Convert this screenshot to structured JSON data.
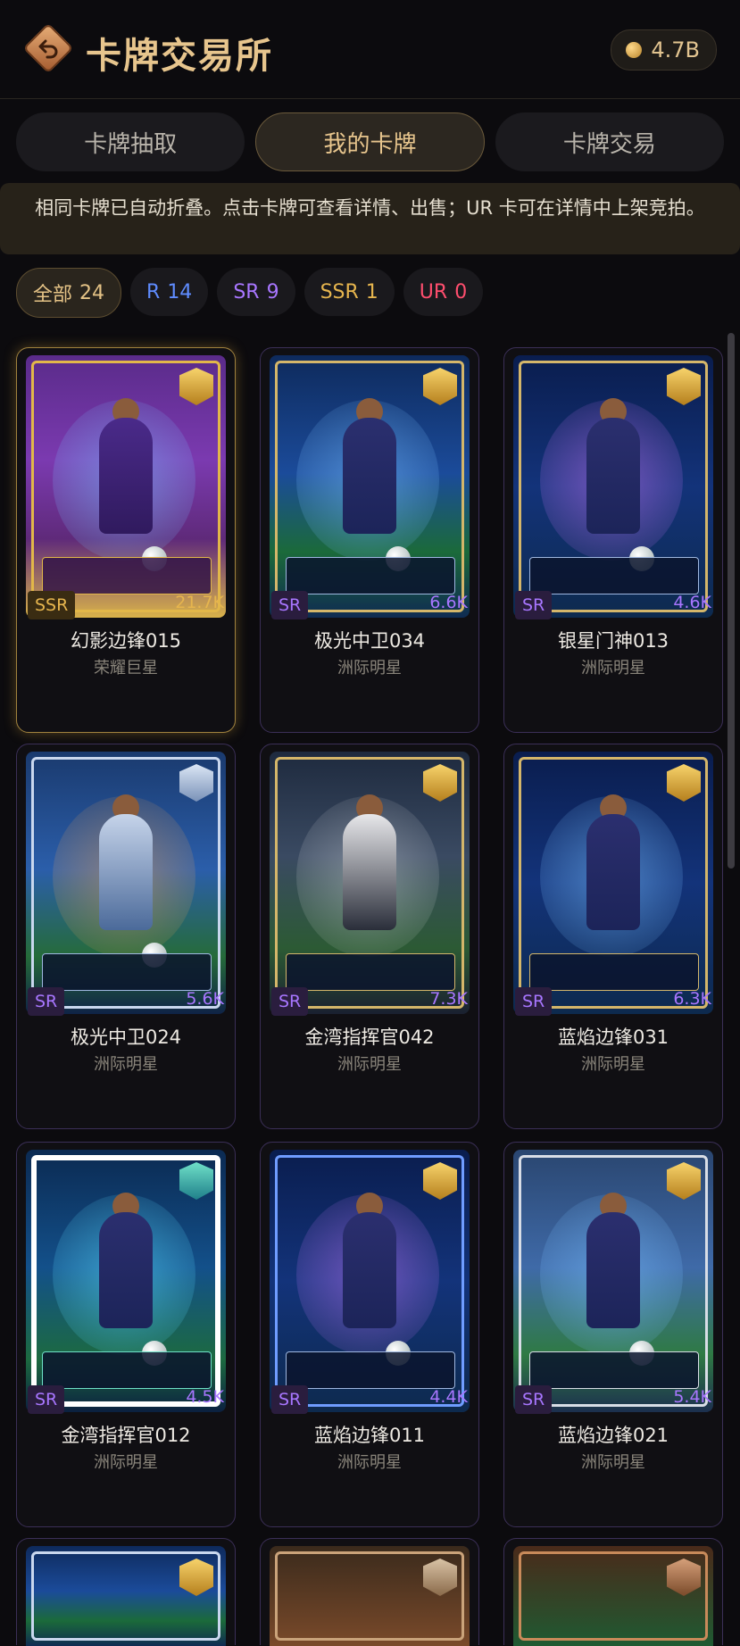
{
  "header": {
    "title": "卡牌交易所",
    "coins": "4.7B"
  },
  "tabs": [
    {
      "label": "卡牌抽取",
      "active": false
    },
    {
      "label": "我的卡牌",
      "active": true
    },
    {
      "label": "卡牌交易",
      "active": false
    }
  ],
  "notice": "相同卡牌已自动折叠。点击卡牌可查看详情、出售；UR 卡可在详情中上架竞拍。",
  "filters": [
    {
      "label": "全部",
      "count": "24",
      "color": "#e5c386",
      "active": true
    },
    {
      "label": "R",
      "count": "14",
      "color": "#5f8cff",
      "active": false
    },
    {
      "label": "SR",
      "count": "9",
      "color": "#a876ff",
      "active": false
    },
    {
      "label": "SSR",
      "count": "1",
      "color": "#e6b54e",
      "active": false
    },
    {
      "label": "UR",
      "count": "0",
      "color": "#ff4e6e",
      "active": false
    }
  ],
  "cards": [
    {
      "rarity": "SSR",
      "price": "21.7K",
      "name": "幻影边锋015",
      "series": "荣耀巨星"
    },
    {
      "rarity": "SR",
      "price": "6.6K",
      "name": "极光中卫034",
      "series": "洲际明星"
    },
    {
      "rarity": "SR",
      "price": "4.6K",
      "name": "银星门神013",
      "series": "洲际明星"
    },
    {
      "rarity": "SR",
      "price": "5.6K",
      "name": "极光中卫024",
      "series": "洲际明星"
    },
    {
      "rarity": "SR",
      "price": "7.3K",
      "name": "金湾指挥官042",
      "series": "洲际明星"
    },
    {
      "rarity": "SR",
      "price": "6.3K",
      "name": "蓝焰边锋031",
      "series": "洲际明星"
    },
    {
      "rarity": "SR",
      "price": "4.5K",
      "name": "金湾指挥官012",
      "series": "洲际明星"
    },
    {
      "rarity": "SR",
      "price": "4.4K",
      "name": "蓝焰边锋011",
      "series": "洲际明星"
    },
    {
      "rarity": "SR",
      "price": "5.4K",
      "name": "蓝焰边锋021",
      "series": "洲际明星"
    }
  ]
}
